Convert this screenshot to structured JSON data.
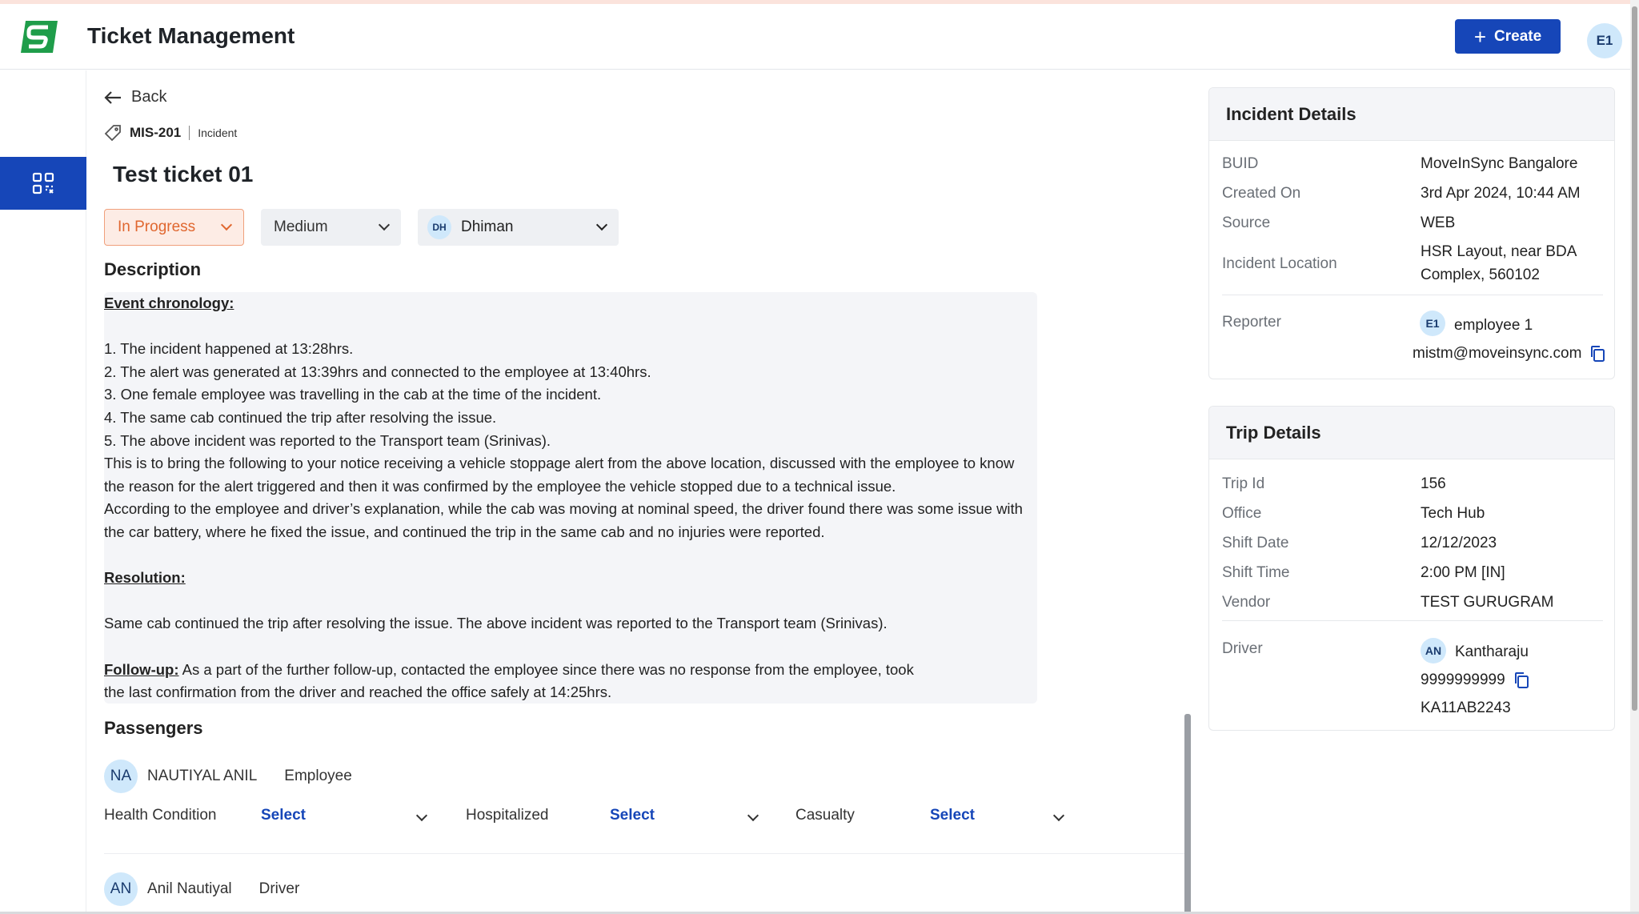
{
  "header": {
    "title": "Ticket Management",
    "create_label": "Create",
    "user_initials": "E1"
  },
  "nav": {
    "back_label": "Back"
  },
  "ticket": {
    "id": "MIS-201",
    "type": "Incident",
    "title": "Test ticket 01",
    "status": "In Progress",
    "priority": "Medium",
    "assignee_initials": "DH",
    "assignee": "Dhiman"
  },
  "description": {
    "heading": "Description",
    "chronology_heading": "Event chronology:",
    "chronology": [
      "1. The incident happened at 13:28hrs.",
      "2. The alert was generated at 13:39hrs and connected to the employee at 13:40hrs.",
      "3. One female employee was travelling in the cab at the time of the incident.",
      "4. The same cab continued the trip after resolving the issue.",
      "5. The above incident was reported to the Transport team (Srinivas)."
    ],
    "para1_line1": "This is to bring the following to your notice receiving a vehicle stoppage alert from the above location, discussed with the employee to know",
    "para1_line2": "the reason for the alert triggered and then it was confirmed by the employee the vehicle stopped due to a technical issue.",
    "para2_line1": "According to the employee and driver’s explanation, while the cab was moving at nominal speed, the driver found there was some issue with",
    "para2_line2": "the car battery, where he fixed the issue, and continued the trip in the same cab and no injuries were reported.",
    "resolution_heading": "Resolution:",
    "resolution": "Same cab continued the trip after resolving the issue. The above incident was reported to the Transport team (Srinivas).",
    "followup_heading": "Follow-up:",
    "followup_line1": " As a part of the further follow-up, contacted the employee since there was no response from the employee, took",
    "followup_line2": "the last confirmation from the driver and reached the office safely at 14:25hrs."
  },
  "passengers": {
    "heading": "Passengers",
    "list": [
      {
        "initials": "NA",
        "name": "NAUTIYAL ANIL",
        "role": "Employee"
      },
      {
        "initials": "AN",
        "name": "Anil Nautiyal",
        "role": "Driver"
      }
    ],
    "fields": {
      "health_label": "Health Condition",
      "health_value": "Select",
      "hospitalized_label": "Hospitalized",
      "hospitalized_value": "Select",
      "casualty_label": "Casualty",
      "casualty_value": "Select"
    }
  },
  "incident_details": {
    "heading": "Incident Details",
    "buid_label": "BUID",
    "buid": "MoveInSync Bangalore",
    "created_label": "Created On",
    "created": "3rd Apr 2024, 10:44 AM",
    "source_label": "Source",
    "source": "WEB",
    "location_label": "Incident Location",
    "location_line1": "HSR Layout, near BDA",
    "location_line2": "Complex, 560102",
    "reporter_label": "Reporter",
    "reporter_initials": "E1",
    "reporter_name": "employee 1",
    "reporter_email": "mistm@moveinsync.com"
  },
  "trip_details": {
    "heading": "Trip Details",
    "trip_id_label": "Trip Id",
    "trip_id": "156",
    "office_label": "Office",
    "office": "Tech Hub",
    "shift_date_label": "Shift Date",
    "shift_date": "12/12/2023",
    "shift_time_label": "Shift Time",
    "shift_time": "2:00 PM [IN]",
    "vendor_label": "Vendor",
    "vendor": "TEST GURUGRAM",
    "driver_label": "Driver",
    "driver_initials": "AN",
    "driver_name": "Kantharaju",
    "driver_phone": "9999999999",
    "vehicle": "KA11AB2243"
  },
  "colors": {
    "brand": "#1646b8",
    "status": "#e0672f",
    "logo": "#1f9d4a",
    "avatar_bg": "#cfe8fb"
  },
  "icons": [
    "app-logo",
    "plus-icon",
    "grid-icon",
    "back-arrow-icon",
    "tag-icon",
    "chevron-down-icon",
    "copy-icon"
  ]
}
